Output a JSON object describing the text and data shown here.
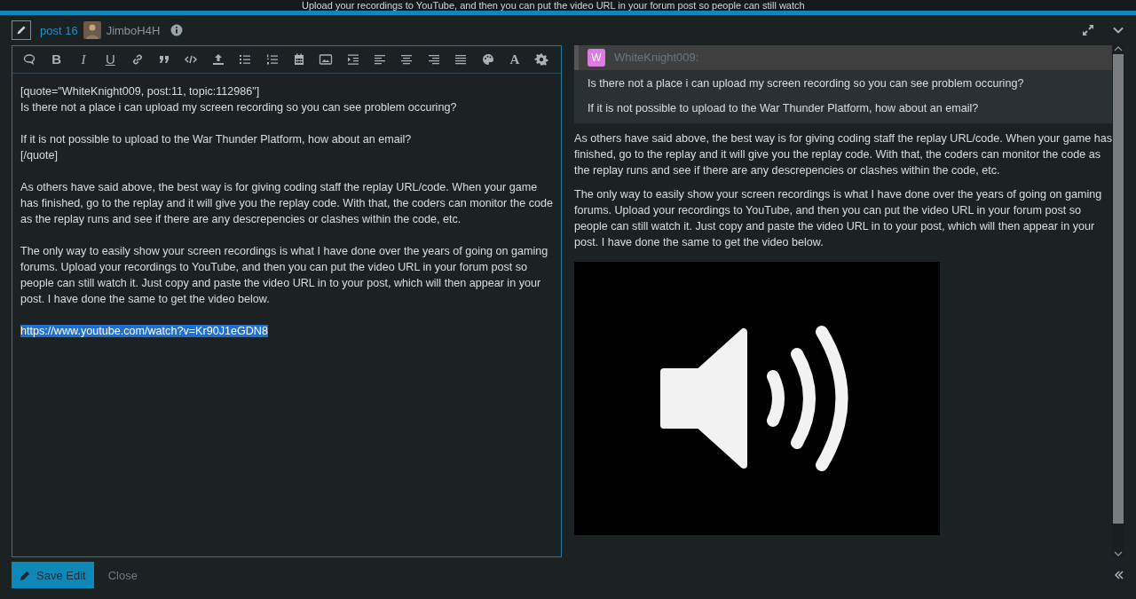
{
  "background_text": "Upload your recordings to YouTube, and then you can put the video URL in your forum post so people can still watch",
  "header": {
    "post_link": "post 16",
    "username": "JimboH4H"
  },
  "toolbar": [
    {
      "kind": "bubble"
    },
    {
      "kind": "bold",
      "label": "B"
    },
    {
      "kind": "italic",
      "label": "I"
    },
    {
      "kind": "underline",
      "label": "U"
    },
    {
      "kind": "link"
    },
    {
      "kind": "quote"
    },
    {
      "kind": "code"
    },
    {
      "kind": "upload"
    },
    {
      "kind": "bullets"
    },
    {
      "kind": "numbers"
    },
    {
      "kind": "calendar"
    },
    {
      "kind": "image"
    },
    {
      "kind": "indent"
    },
    {
      "kind": "left"
    },
    {
      "kind": "center"
    },
    {
      "kind": "right"
    },
    {
      "kind": "justify"
    },
    {
      "kind": "palette"
    },
    {
      "kind": "font",
      "label": "A"
    },
    {
      "kind": "gear"
    }
  ],
  "editor": {
    "blocks": [
      {
        "lines": [
          "[quote=\"WhiteKnight009, post:11, topic:112986\"]",
          "Is there not a place i can upload my screen recording so you can see problem occuring?"
        ]
      },
      {
        "lines": [
          "If it is not possible to upload to the War Thunder Platform, how about an email?",
          "[/quote]"
        ]
      },
      {
        "lines": [
          "As others have said above, the best way is for giving coding staff the replay URL/code. When your game has finished, go to the replay and it will give you the replay code. With that, the coders can monitor the code as the replay runs and see if there are any descrepencies or clashes within the code, etc."
        ]
      },
      {
        "lines": [
          "The only way to easily show your screen recordings is what I have done over the years of going on gaming forums. Upload your recordings to YouTube, and then you can put the video URL in your forum post so people can still watch it. Just copy and paste the video URL in to your post, which will then appear in your post. I have done the same to get the video below."
        ]
      },
      {
        "lines": [
          "https://www.youtube.com/watch?v=Kr90J1eGDN8"
        ],
        "selected": true
      }
    ]
  },
  "preview": {
    "quote": {
      "avatar_letter": "W",
      "color": "#e07be6",
      "author": "WhiteKnight009:",
      "paragraphs": [
        "Is there not a place i can upload my screen recording so you can see problem occuring?",
        "If it is not possible to upload to the War Thunder Platform, how about an email?"
      ]
    },
    "paragraphs": [
      "As others have said above, the best way is for giving coding staff the replay URL/code. When your game has finished, go to the replay and it will give you the replay code. With that, the coders can monitor the code as the replay runs and see if there are any descrepencies or clashes within the code, etc.",
      "The only way to easily show your screen recordings is what I have done over the years of going on gaming forums. Upload your recordings to YouTube, and then you can put the video URL in your forum post so people can still watch it. Just copy and paste the video URL in to your post, which will then appear in your post. I have done the same to get the video below."
    ]
  },
  "footer": {
    "save_button": "Save Edit",
    "close_link": "Close"
  }
}
